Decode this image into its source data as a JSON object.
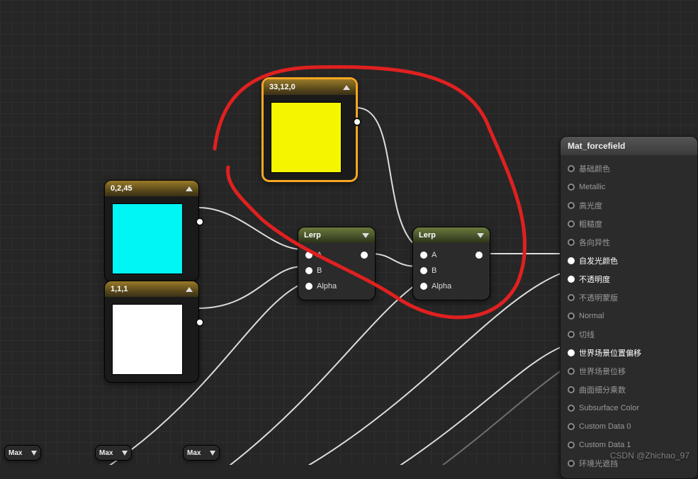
{
  "nodes": {
    "const_yellow": {
      "title": "33,12,0",
      "color": "#f5f500"
    },
    "const_cyan": {
      "title": "0,2,45",
      "color": "#00f5f5"
    },
    "const_white": {
      "title": "1,1,1",
      "color": "#ffffff"
    },
    "lerp1": {
      "title": "Lerp",
      "pins": {
        "a": "A",
        "b": "B",
        "alpha": "Alpha"
      }
    },
    "lerp2": {
      "title": "Lerp",
      "pins": {
        "a": "A",
        "b": "B",
        "alpha": "Alpha"
      }
    }
  },
  "result": {
    "title": "Mat_forcefield",
    "pins": [
      {
        "key": "base_color",
        "label": "基础颜色",
        "active": false
      },
      {
        "key": "metallic",
        "label": "Metallic",
        "active": false
      },
      {
        "key": "specular",
        "label": "高光度",
        "active": false
      },
      {
        "key": "roughness",
        "label": "粗糙度",
        "active": false
      },
      {
        "key": "anisotropy",
        "label": "各向异性",
        "active": false
      },
      {
        "key": "emissive",
        "label": "自发光颜色",
        "active": true
      },
      {
        "key": "opacity",
        "label": "不透明度",
        "active": true
      },
      {
        "key": "opacity_mask",
        "label": "不透明蒙版",
        "active": false
      },
      {
        "key": "normal",
        "label": "Normal",
        "active": false
      },
      {
        "key": "tangent",
        "label": "切线",
        "active": false
      },
      {
        "key": "wpo",
        "label": "世界场景位置偏移",
        "active": true
      },
      {
        "key": "wd",
        "label": "世界场景位移",
        "active": false
      },
      {
        "key": "tess",
        "label": "曲面细分乘数",
        "active": false
      },
      {
        "key": "subsurface",
        "label": "Subsurface Color",
        "active": false
      },
      {
        "key": "custom0",
        "label": "Custom Data 0",
        "active": false
      },
      {
        "key": "custom1",
        "label": "Custom Data 1",
        "active": false
      },
      {
        "key": "ao",
        "label": "环境光遮挡",
        "active": false
      }
    ]
  },
  "mini_nodes": {
    "m1": "Max",
    "m2": "Max",
    "m3": "Max"
  },
  "watermark": "CSDN @Zhichao_97",
  "annotation_color": "#e02020"
}
